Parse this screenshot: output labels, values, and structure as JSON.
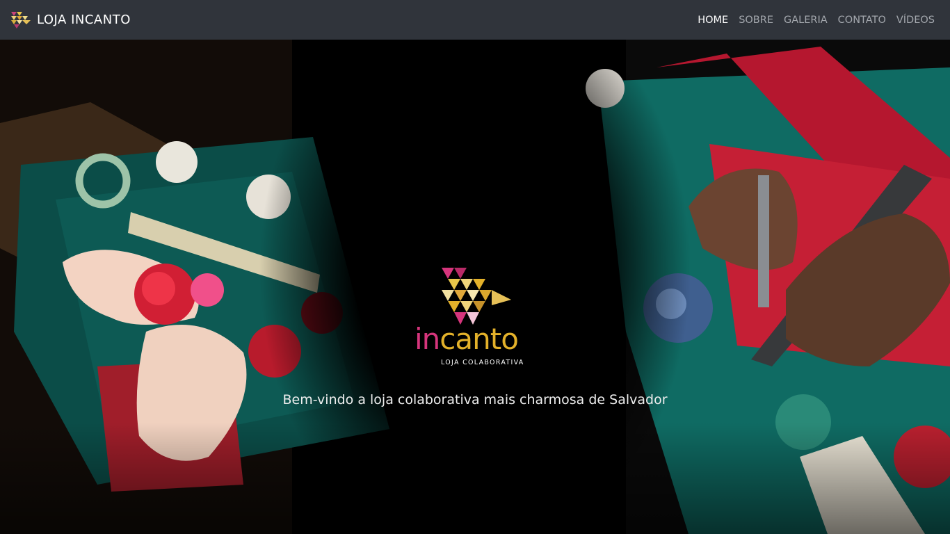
{
  "brand": {
    "name": "LOJA INCANTO",
    "logo_icon": "incanto-triangle-logo-icon"
  },
  "nav": {
    "items": [
      {
        "label": "HOME",
        "active": true
      },
      {
        "label": "SOBRE",
        "active": false
      },
      {
        "label": "GALERIA",
        "active": false
      },
      {
        "label": "CONTATO",
        "active": false
      },
      {
        "label": "VÍDEOS",
        "active": false
      }
    ]
  },
  "hero": {
    "logo_word_in": "in",
    "logo_word_canto": "canto",
    "logo_subtitle": "LOJA COLABORATIVA",
    "tagline": "Bem-vindo a loja colaborativa mais charmosa de Salvador"
  },
  "colors": {
    "navbar_bg": "#30343b",
    "nav_active": "#ffffff",
    "nav_inactive": "#a3a7ad",
    "brand_magenta": "#d6357c",
    "brand_gold": "#e3b12a"
  }
}
